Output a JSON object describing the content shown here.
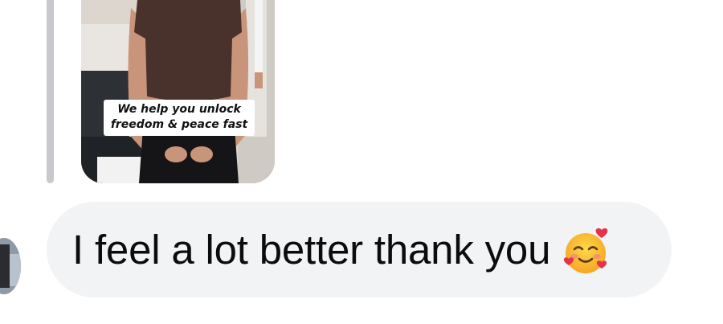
{
  "shared_media": {
    "caption_line1": "We help you unlock",
    "caption_line2": "freedom & peace fast"
  },
  "message": {
    "text": "I feel a lot better thank you",
    "emoji": "smiling-face-with-hearts-icon"
  },
  "colors": {
    "bubble_background": "#f1f3f5",
    "quote_bar": "#c8c8cc",
    "text": "#0c0c0c"
  }
}
